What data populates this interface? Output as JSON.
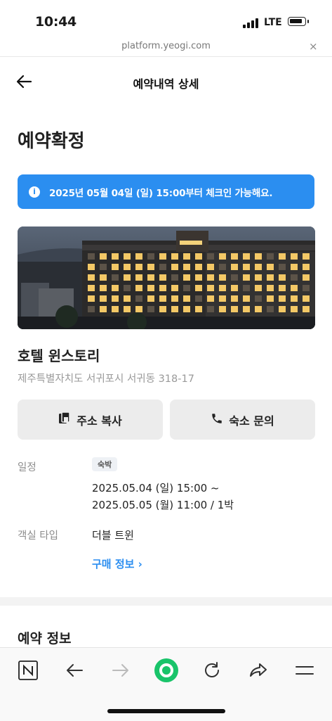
{
  "status_bar": {
    "time": "10:44",
    "network": "LTE",
    "battery_level": 0.9
  },
  "browser": {
    "url": "platform.yeogi.com",
    "close_glyph": "×"
  },
  "header": {
    "title": "예약내역 상세"
  },
  "reservation_status": "예약확정",
  "notice": {
    "icon": "i",
    "text": "2025년 05월 04일 (일) 15:00부터 체크인 가능해요."
  },
  "hotel": {
    "name": "호텔 윈스토리",
    "address": "제주특별자치도 서귀포시 서귀동 318-17"
  },
  "buttons": {
    "copy_address": "주소 복사",
    "contact": "숙소 문의"
  },
  "details": {
    "schedule_label": "일정",
    "stay_badge": "숙박",
    "checkin": "2025.05.04 (일) 15:00 ~",
    "checkout": "2025.05.05 (월) 11:00 / 1박",
    "room_type_label": "객실 타입",
    "room_type": "더블 트윈",
    "purchase_info_link": "구매 정보 ›"
  },
  "section": {
    "reservation_info_title": "예약 정보"
  },
  "colors": {
    "accent": "#2b8ef0",
    "button_bg": "#ececec",
    "nav_green": "#19c46a"
  },
  "bottom_nav": [
    "naver-icon",
    "back-arrow-icon",
    "forward-arrow-icon",
    "green-dot-icon",
    "refresh-icon",
    "share-icon",
    "menu-icon"
  ]
}
